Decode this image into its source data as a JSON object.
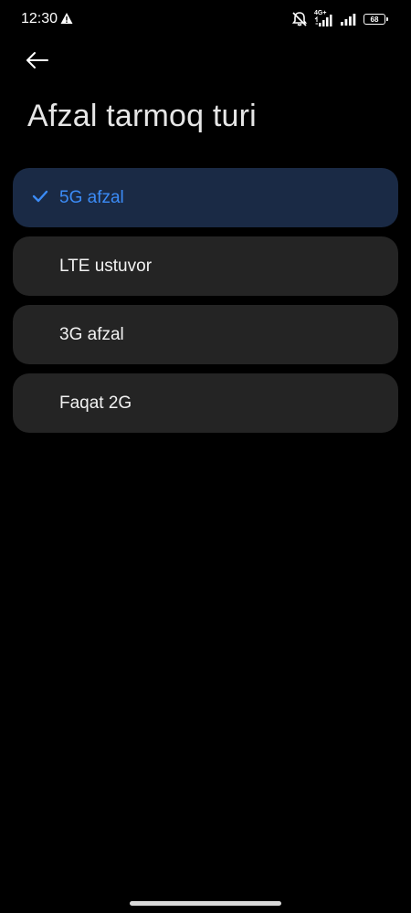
{
  "status_bar": {
    "time": "12:30",
    "network_type": "4G+",
    "battery_level": "68",
    "icons": [
      "warning-icon",
      "mute-icon",
      "signal-icon",
      "signal-icon",
      "battery-icon"
    ]
  },
  "header": {
    "back_icon": "arrow-left-icon",
    "title": "Afzal tarmoq turi"
  },
  "options": [
    {
      "label": "5G afzal",
      "selected": true
    },
    {
      "label": "LTE ustuvor",
      "selected": false
    },
    {
      "label": "3G afzal",
      "selected": false
    },
    {
      "label": "Faqat 2G",
      "selected": false
    }
  ],
  "colors": {
    "background": "#000000",
    "option_bg": "#242424",
    "selected_bg": "#1a2a45",
    "accent": "#3b8bf6",
    "text": "#f2f2f2"
  }
}
